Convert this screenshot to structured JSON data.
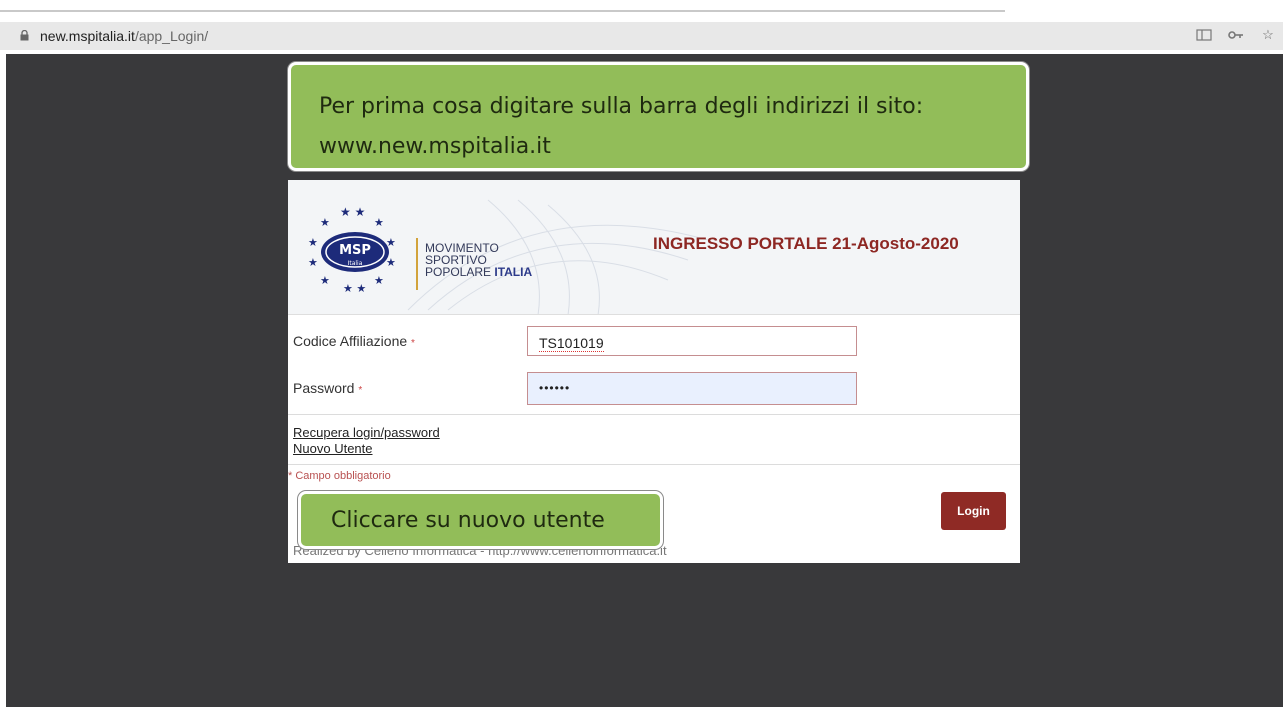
{
  "browser": {
    "url_host": "new.mspitalia.it",
    "url_path": "/app_Login/",
    "icons": [
      "page-action-icon",
      "key-icon",
      "star-icon"
    ]
  },
  "callouts": {
    "top_line1": "Per prima cosa digitare sulla barra degli indirizzi il sito:",
    "top_line2": "www.new.mspitalia.it",
    "bottom": "Cliccare su nuovo utente"
  },
  "logo": {
    "badge_text": "MSP",
    "badge_sub": "Italia",
    "org_line1": "MOVIMENTO",
    "org_line2": "SPORTIVO",
    "org_line3_a": "POPOLARE ",
    "org_line3_b": "ITALIA"
  },
  "portal": {
    "title": "INGRESSO PORTALE 21-Agosto-2020"
  },
  "form": {
    "code_label": "Codice Affiliazione",
    "code_value": "TS101019",
    "password_label": "Password",
    "password_value": "••••••",
    "required_mark": "*"
  },
  "links": {
    "recover": "Recupera login/password",
    "new_user": "Nuovo Utente"
  },
  "note": "* Campo obbligatorio",
  "login_button": "Login",
  "footer": "Realized by Celleno Informatica - http://www.cellenoinformatica.it",
  "colors": {
    "callout": "#92bd59",
    "title": "#8d2723",
    "button": "#8f2a25",
    "background": "#39393b"
  }
}
